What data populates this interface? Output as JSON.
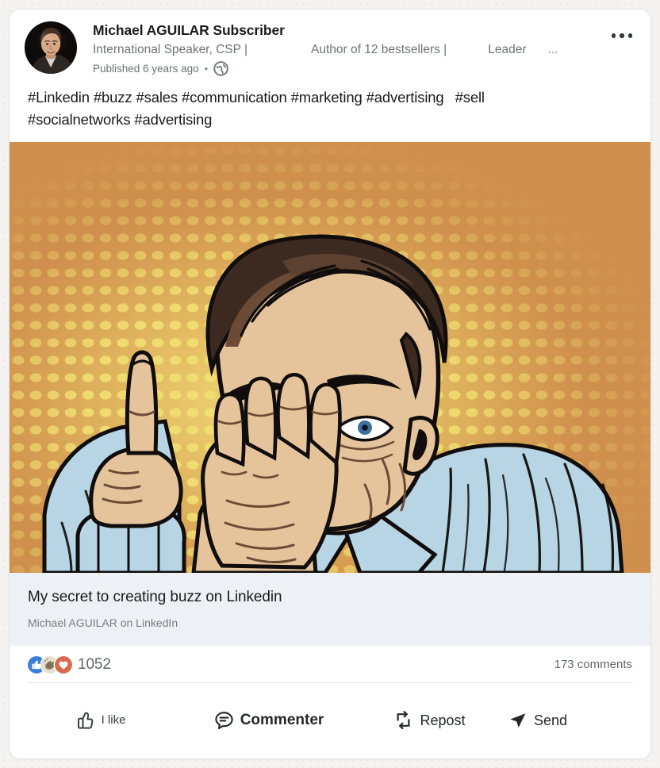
{
  "post": {
    "author": {
      "name": "Michael AGUILAR Subscriber",
      "headline_part_1": "International Speaker, CSP |",
      "headline_part_2": "Author of 12 bestsellers |",
      "headline_part_3": "Leader",
      "headline_ellipsis": "...",
      "avatar_alt": "Michael AGUILAR profile photo"
    },
    "published": "Published 6 years ago",
    "visibility_icon": "globe-icon",
    "separator_dot": "•",
    "more_menu_icon": "ellipsis-icon",
    "commentary_line_1": "#Linkedin #buzz #sales #communication #marketing #advertising",
    "commentary_line_1b": "#sell",
    "commentary_line_2": "#socialnetworks #advertising",
    "media_alt": "Pop art comic illustration of a man whispering a secret with his hand over his mouth, finger raised",
    "link_preview": {
      "title": "My secret to creating buzz on Linkedin",
      "subtitle": "Michael AGUILAR on LinkedIn"
    },
    "social": {
      "reaction_count": "1052",
      "comments": "173 comments",
      "reaction_icons": [
        "like-thumb-icon",
        "clap-hands-icon",
        "love-heart-icon"
      ]
    },
    "actions": [
      {
        "label": "I like",
        "icon": "thumb-up-outline-icon"
      },
      {
        "label": "Commenter",
        "icon": "comment-bubble-icon"
      },
      {
        "label": "Repost",
        "icon": "repost-arrows-icon"
      },
      {
        "label": "Send",
        "icon": "send-plane-icon"
      }
    ]
  },
  "colors": {
    "card_background": "#ffffff",
    "page_background": "#f4f3f1",
    "link_preview_background": "#edf0f4",
    "primary_text": "#1b1b1b",
    "secondary_text": "#6f7276",
    "divider": "#e6e7e8",
    "media_orange": "#cf8f4d",
    "media_yellow": "#f0de72",
    "shirt_blue": "#b7d5e4",
    "tie_purple": "#7c4f93",
    "reaction_like_blue": "#3c7dd9",
    "reaction_clap_olive": "#897a5e",
    "reaction_love_coral": "#d96a4e"
  }
}
